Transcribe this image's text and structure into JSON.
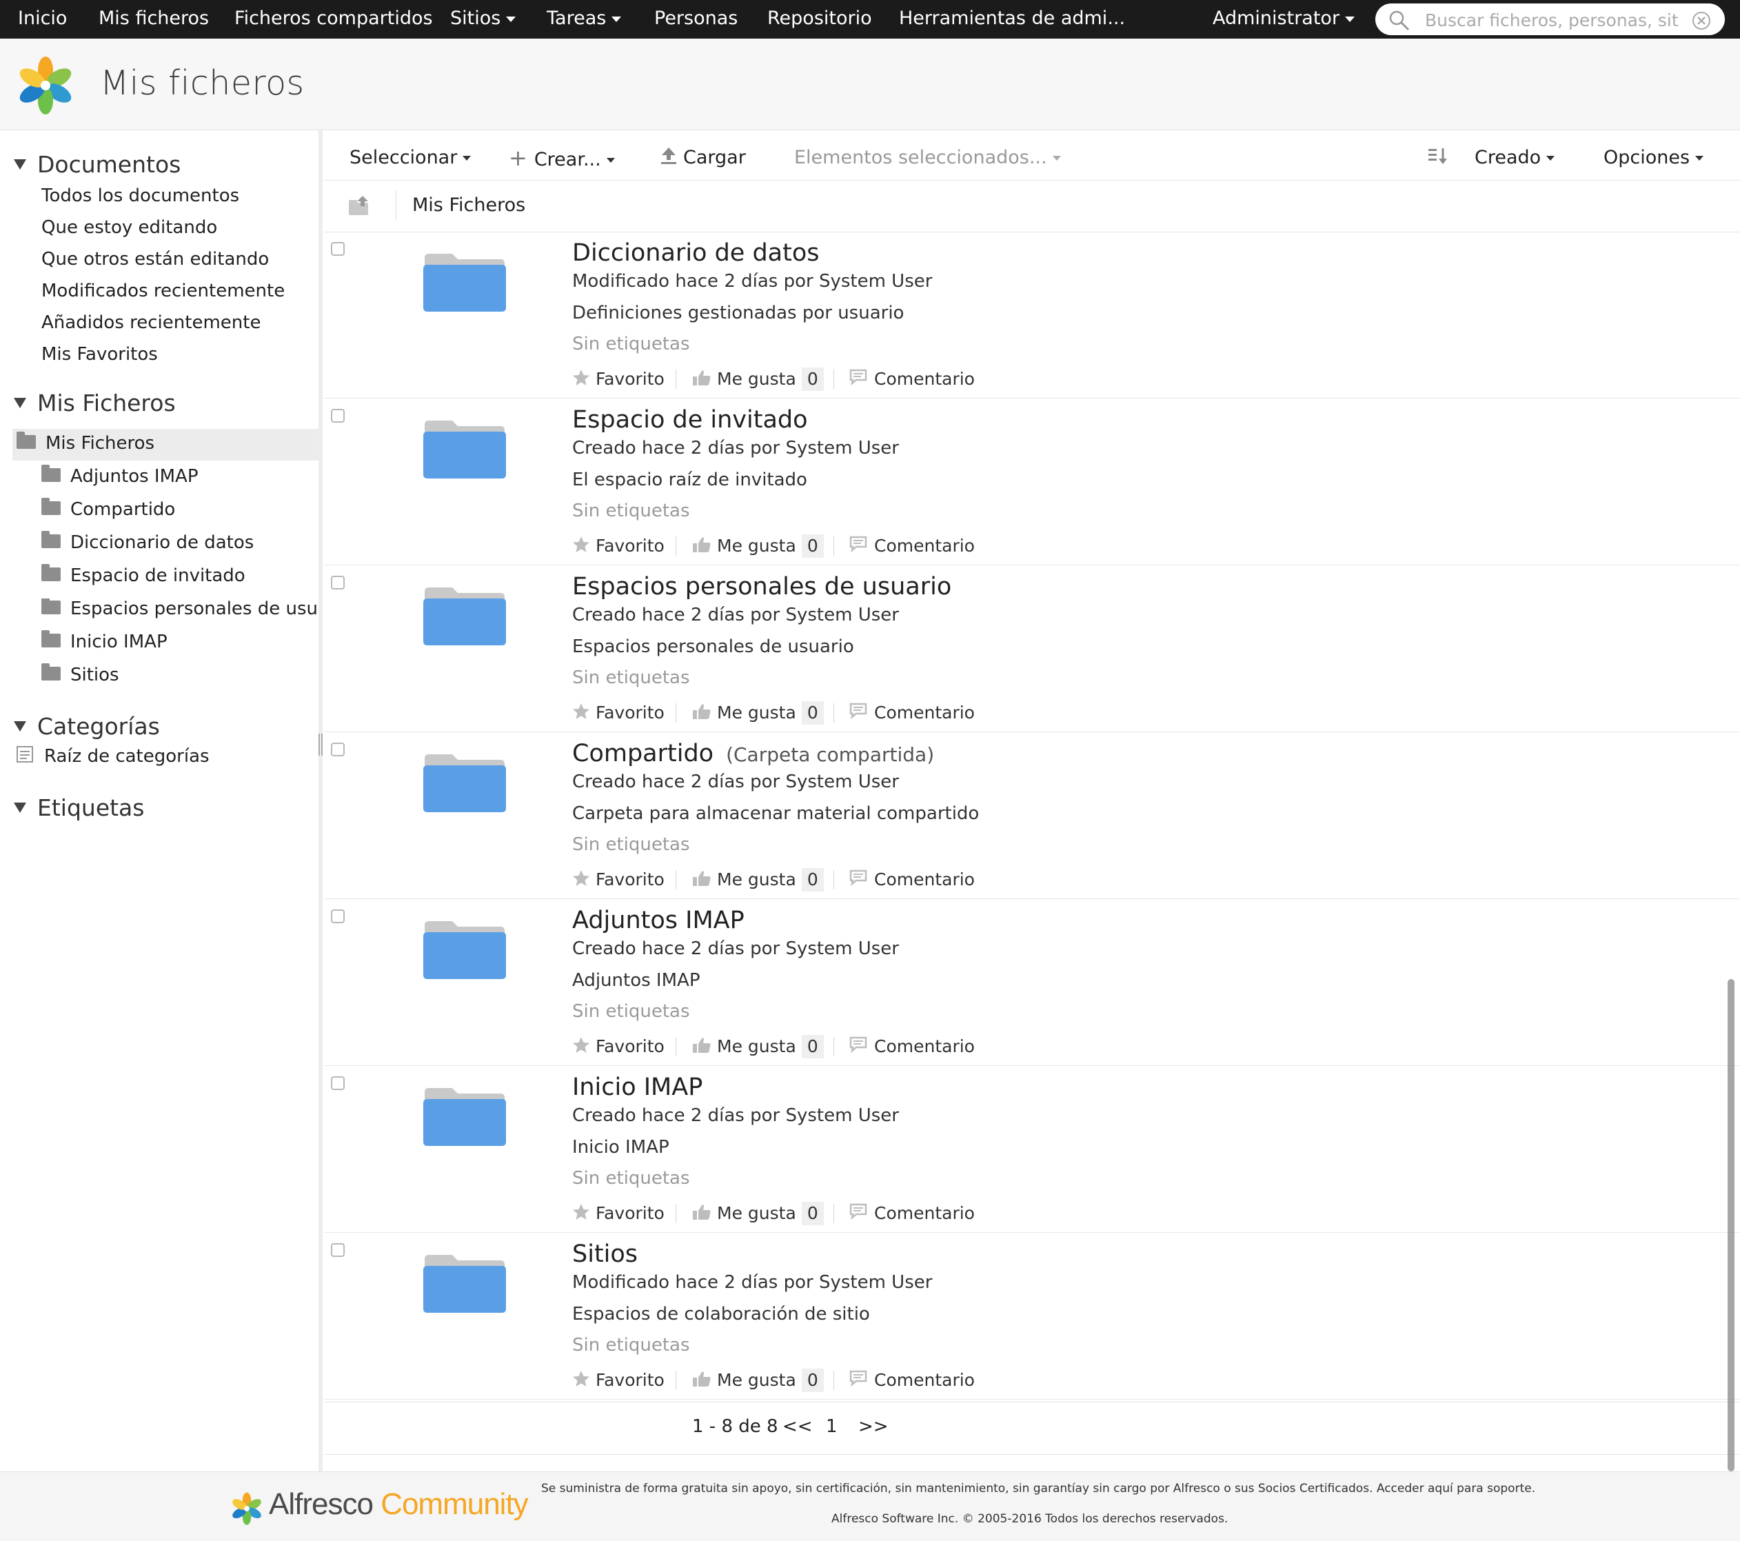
{
  "topnav": {
    "items": [
      "Inicio",
      "Mis ficheros",
      "Ficheros compartidos",
      "Sitios",
      "Tareas",
      "Personas",
      "Repositorio",
      "Herramientas de admi..."
    ],
    "user": "Administrator",
    "search_placeholder": "Buscar ficheros, personas, siti"
  },
  "header": {
    "title": "Mis ficheros"
  },
  "sidebar": {
    "documents": {
      "heading": "Documentos",
      "links": [
        "Todos los documentos",
        "Que estoy editando",
        "Que otros están editando",
        "Modificados recientemente",
        "Añadidos recientemente",
        "Mis Favoritos"
      ]
    },
    "myfiles": {
      "heading": "Mis Ficheros",
      "root": "Mis Ficheros",
      "children": [
        "Adjuntos IMAP",
        "Compartido",
        "Diccionario de datos",
        "Espacio de invitado",
        "Espacios personales de usuar",
        "Inicio IMAP",
        "Sitios"
      ]
    },
    "categories": {
      "heading": "Categorías",
      "root": "Raíz de categorías"
    },
    "tags": {
      "heading": "Etiquetas"
    }
  },
  "toolbar": {
    "select": "Seleccionar",
    "create": "Crear...",
    "upload": "Cargar",
    "selected_items": "Elementos seleccionados...",
    "sort": "Creado",
    "options": "Opciones"
  },
  "breadcrumb": {
    "current": "Mis Ficheros"
  },
  "actions": {
    "favorite": "Favorito",
    "like": "Me gusta",
    "comment": "Comentario"
  },
  "rows": [
    {
      "title": "Diccionario de datos",
      "extra": "",
      "meta": "Modificado hace 2 días por System User",
      "desc": "Definiciones gestionadas por usuario",
      "tags": "Sin etiquetas",
      "likes": "0"
    },
    {
      "title": "Espacio de invitado",
      "extra": "",
      "meta": "Creado hace 2 días por System User",
      "desc": "El espacio raíz de invitado",
      "tags": "Sin etiquetas",
      "likes": "0"
    },
    {
      "title": "Espacios personales de usuario",
      "extra": "",
      "meta": "Creado hace 2 días por System User",
      "desc": "Espacios personales de usuario",
      "tags": "Sin etiquetas",
      "likes": "0"
    },
    {
      "title": "Compartido",
      "extra": "(Carpeta compartida)",
      "meta": "Creado hace 2 días por System User",
      "desc": "Carpeta para almacenar material compartido",
      "tags": "Sin etiquetas",
      "likes": "0"
    },
    {
      "title": "Adjuntos IMAP",
      "extra": "",
      "meta": "Creado hace 2 días por System User",
      "desc": "Adjuntos IMAP",
      "tags": "Sin etiquetas",
      "likes": "0"
    },
    {
      "title": "Inicio IMAP",
      "extra": "",
      "meta": "Creado hace 2 días por System User",
      "desc": "Inicio IMAP",
      "tags": "Sin etiquetas",
      "likes": "0"
    },
    {
      "title": "Sitios",
      "extra": "",
      "meta": "Modificado hace 2 días por System User",
      "desc": "Espacios de colaboración de sitio",
      "tags": "Sin etiquetas",
      "likes": "0"
    }
  ],
  "pagination": {
    "range": "1 - 8 de 8",
    "prev": "<<",
    "page": "1",
    "next": ">>"
  },
  "footer": {
    "brand_a": "Alfresco",
    "brand_b": "Community",
    "line1": "Se suministra de forma gratuita sin apoyo, sin certificación, sin mantenimiento, sin garantíay sin cargo por Alfresco o sus Socios Certificados. Acceder aquí para soporte.",
    "line2": "Alfresco Software Inc. © 2005-2016 Todos los derechos reservados."
  },
  "colors": {
    "folder_front": "#5a9fe6",
    "folder_back": "#c9c9c9",
    "nav_bg": "#1b1b1b",
    "brand_orange": "#f5a623"
  }
}
